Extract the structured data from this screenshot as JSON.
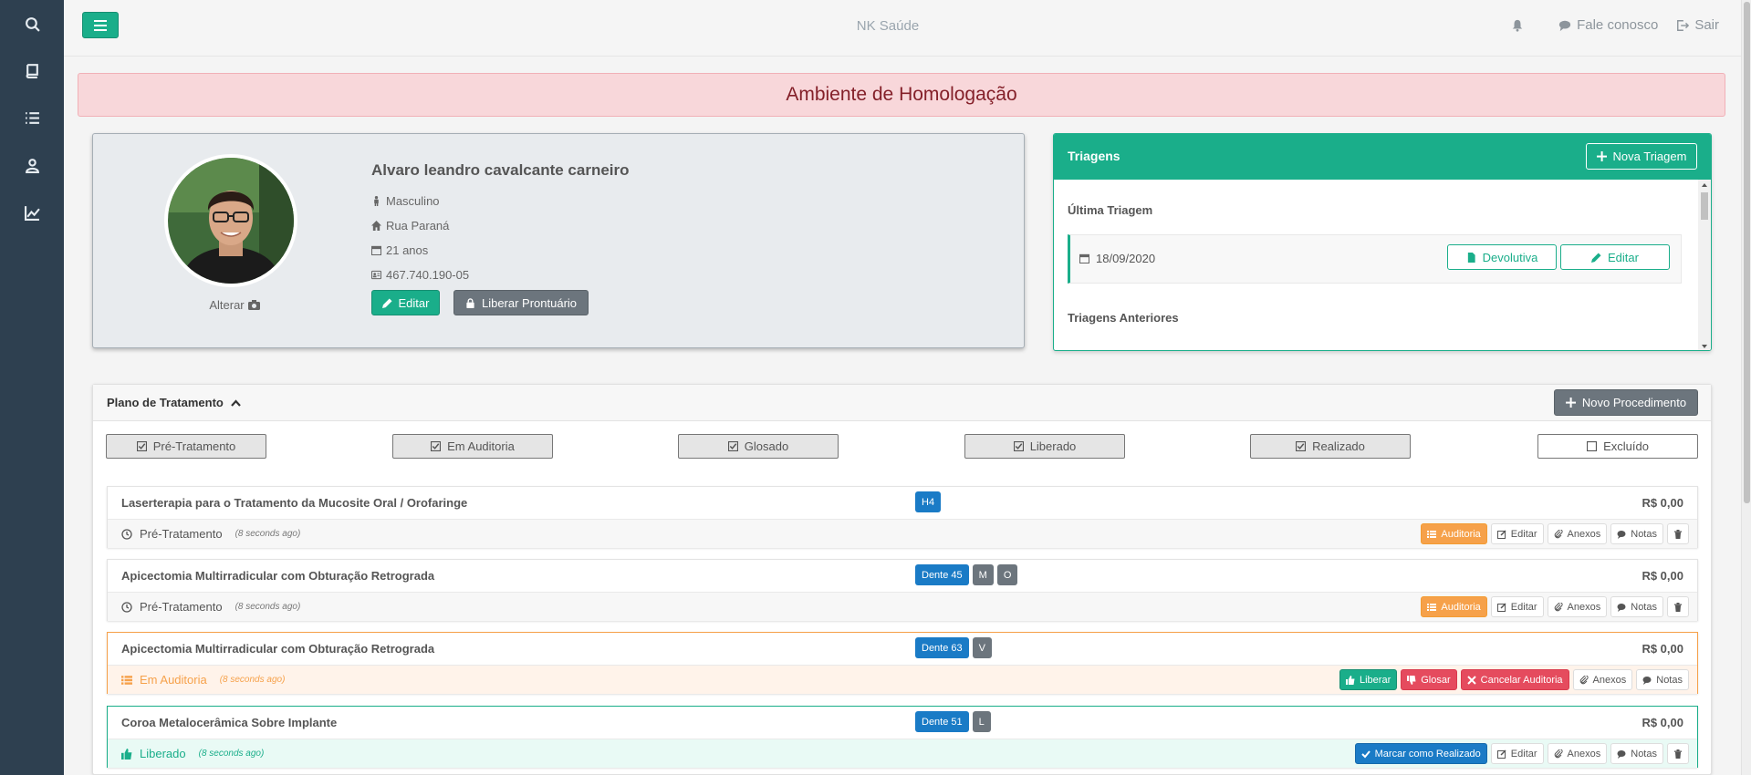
{
  "app": {
    "title": "NK Saúde"
  },
  "header": {
    "fale_conosco": "Fale conosco",
    "sair": "Sair"
  },
  "alert": {
    "text": "Ambiente de Homologação"
  },
  "patient": {
    "name": "Alvaro leandro cavalcante carneiro",
    "gender": "Masculino",
    "address": "Rua Paraná",
    "age": "21 anos",
    "document": "467.740.190-05",
    "alterar_label": "Alterar",
    "edit_label": "Editar",
    "release_label": "Liberar Prontuário"
  },
  "triagens": {
    "title": "Triagens",
    "new_label": "Nova Triagem",
    "last_label": "Última Triagem",
    "last_date": "18/09/2020",
    "devolutiva_label": "Devolutiva",
    "edit_label": "Editar",
    "previous_label": "Triagens Anteriores"
  },
  "plano": {
    "title": "Plano de Tratamento",
    "new_label": "Novo Procedimento",
    "filters": [
      {
        "label": "Pré-Tratamento",
        "checked": true
      },
      {
        "label": "Em Auditoria",
        "checked": true
      },
      {
        "label": "Glosado",
        "checked": true
      },
      {
        "label": "Liberado",
        "checked": true
      },
      {
        "label": "Realizado",
        "checked": true
      },
      {
        "label": "Excluído",
        "checked": false
      }
    ],
    "procedures": [
      {
        "name": "Laserterapia para o Tratamento da Mucosite Oral / Orofaringe",
        "tags": [
          "H4"
        ],
        "price": "R$ 0,00",
        "status": "Pré-Tratamento",
        "ago": "(8 seconds ago)",
        "actions": [
          "Auditoria",
          "Editar",
          "Anexos",
          "Notas"
        ]
      },
      {
        "name": "Apicectomia Multirradicular com Obturação Retrograda",
        "tags": [
          "Dente 45",
          "M",
          "O"
        ],
        "price": "R$ 0,00",
        "status": "Pré-Tratamento",
        "ago": "(8 seconds ago)",
        "actions": [
          "Auditoria",
          "Editar",
          "Anexos",
          "Notas"
        ]
      },
      {
        "name": "Apicectomia Multirradicular com Obturação Retrograda",
        "tags": [
          "Dente 63",
          "V"
        ],
        "price": "R$ 0,00",
        "status": "Em Auditoria",
        "ago": "(8 seconds ago)",
        "actions": [
          "Liberar",
          "Glosar",
          "Cancelar Auditoria",
          "Anexos",
          "Notas"
        ]
      },
      {
        "name": "Coroa Metalocerâmica Sobre Implante",
        "tags": [
          "Dente 51",
          "L"
        ],
        "price": "R$ 0,00",
        "status": "Liberado",
        "ago": "(8 seconds ago)",
        "actions": [
          "Marcar como Realizado",
          "Editar",
          "Anexos",
          "Notas"
        ]
      }
    ]
  },
  "colors": {
    "primary": "#1aae8a",
    "sidebar": "#2e4050",
    "warning": "#f6a14a",
    "danger": "#e54b5e",
    "info": "#1a7bc6"
  }
}
